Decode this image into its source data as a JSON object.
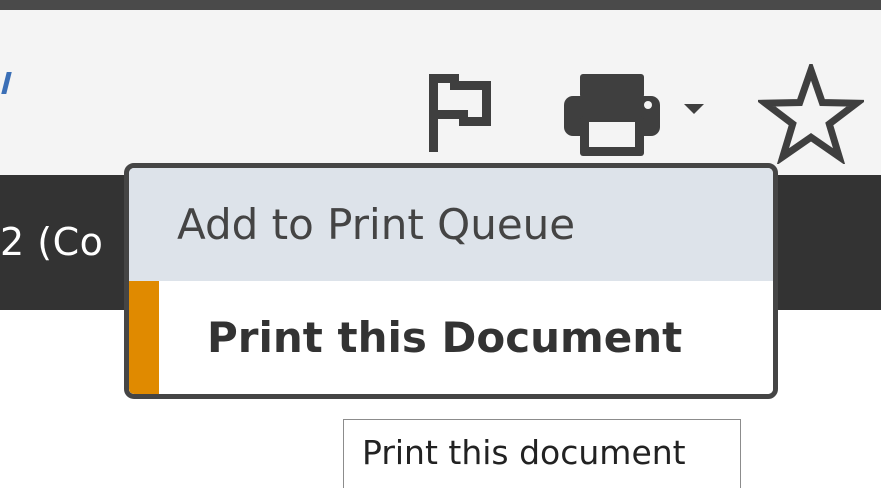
{
  "toolbar": {
    "flag_icon": "flag-outline-icon",
    "print_icon": "printer-icon",
    "print_dropdown_icon": "caret-down-icon",
    "bookmark_icon": "star-outline-icon"
  },
  "background": {
    "partial_text": "2 (Co"
  },
  "print_menu": {
    "items": [
      {
        "label": "Add to Print Queue"
      },
      {
        "label": "Print this Document",
        "selected": true
      }
    ]
  },
  "tooltip": {
    "text": "Print this document"
  },
  "colors": {
    "accent": "#e08a00",
    "hover_bg": "#dde3ea",
    "toolbar_bg": "#f4f4f4",
    "band_bg": "#333333",
    "icon": "#3f3f3f"
  }
}
